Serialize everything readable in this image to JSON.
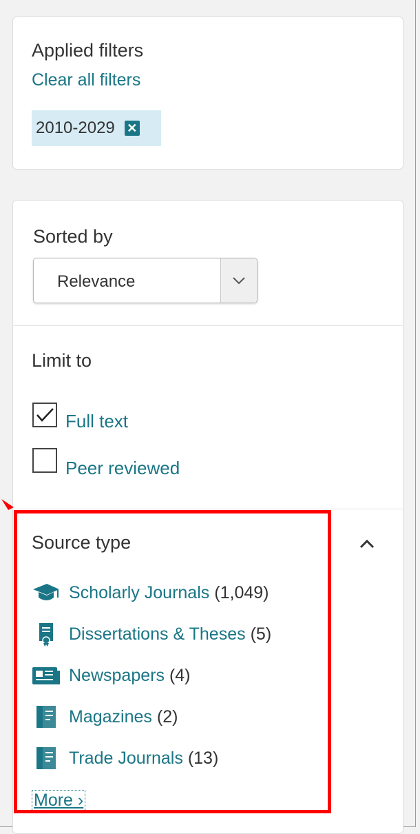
{
  "applied_filters": {
    "heading": "Applied filters",
    "clear_link": "Clear all filters",
    "chips": [
      {
        "label": "2010-2029",
        "remove_glyph": "✕"
      }
    ]
  },
  "sorted_by": {
    "heading": "Sorted by",
    "selected": "Relevance"
  },
  "limit_to": {
    "heading": "Limit to",
    "options": [
      {
        "label": "Full text",
        "checked": true
      },
      {
        "label": "Peer reviewed",
        "checked": false
      }
    ]
  },
  "source_type": {
    "heading": "Source type",
    "items": [
      {
        "icon": "graduation-cap-icon",
        "label": "Scholarly Journals",
        "count": "(1,049)"
      },
      {
        "icon": "dissertation-icon",
        "label": "Dissertations & Theses",
        "count": "(5)"
      },
      {
        "icon": "newspaper-icon",
        "label": "Newspapers",
        "count": "(4)"
      },
      {
        "icon": "magazine-icon",
        "label": "Magazines",
        "count": "(2)"
      },
      {
        "icon": "trade-journal-icon",
        "label": "Trade Journals",
        "count": "(13)"
      }
    ],
    "more_link": "More ›"
  },
  "colors": {
    "accent": "#1a7686",
    "chip_bg": "#d6ebf4",
    "highlight": "#ff0000"
  }
}
